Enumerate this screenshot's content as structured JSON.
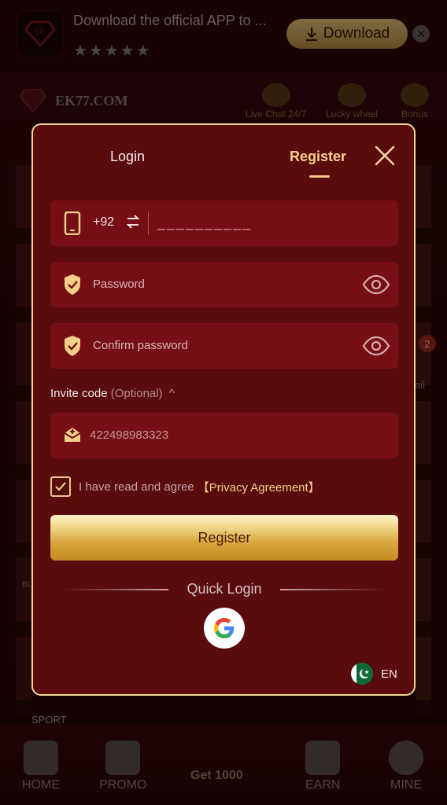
{
  "banner": {
    "text": "Download the official APP to ...",
    "stars": "★★★★★",
    "download_label": "Download",
    "close_glyph": "✕"
  },
  "site": {
    "name": "EK77.COM",
    "top_icons": [
      "Live Chat 24/7",
      "Lucky wheel",
      "Bonus"
    ]
  },
  "background": {
    "badge_count": "2",
    "sport_label": "SPORT",
    "bl_label": "BL",
    "ail_label": "ail"
  },
  "modal": {
    "tabs": {
      "login": "Login",
      "register": "Register"
    },
    "phone": {
      "country_code": "+92",
      "placeholder": "__________"
    },
    "password": {
      "placeholder": "Password"
    },
    "confirm_password": {
      "placeholder": "Confirm password"
    },
    "invite": {
      "label": "Invite code",
      "optional": "(Optional)",
      "caret": "^",
      "value": "422498983323"
    },
    "agreement": {
      "text": "I have read and agree",
      "link": "【Privacy Agreement】",
      "checked": true
    },
    "register_button": "Register",
    "quick_login": "Quick Login",
    "language": "EN"
  },
  "bottom_nav": {
    "items": [
      "HOME",
      "PROMO",
      "Get 1000",
      "EARN",
      "MINE"
    ]
  },
  "colors": {
    "modal_bg": "#5a0b0e",
    "field_bg": "#760f15",
    "accent_gold": "#f3d08a",
    "border_gold": "#f2d49a"
  }
}
